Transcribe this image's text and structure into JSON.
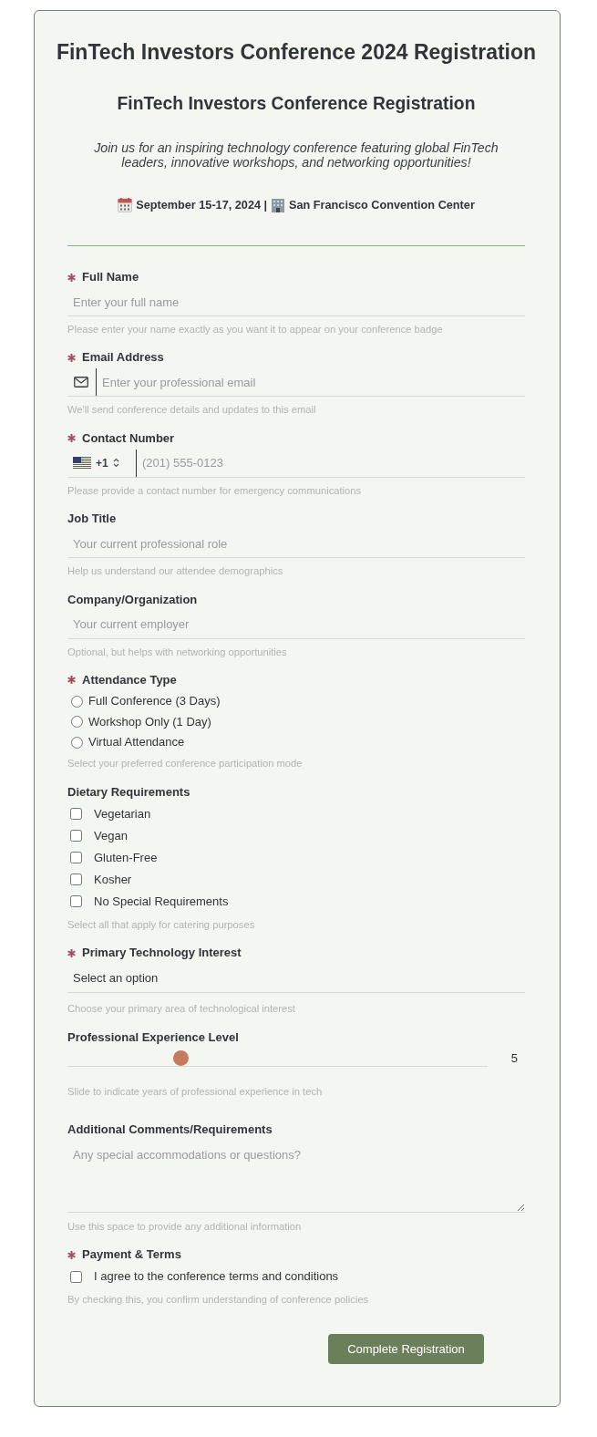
{
  "header": {
    "title": "FinTech Investors Conference 2024 Registration",
    "subtitle": "FinTech Investors Conference Registration",
    "description": "Join us for an inspiring technology conference featuring global FinTech leaders, innovative workshops, and networking opportunities!",
    "event_details": [
      {
        "kind": "date",
        "text": "September 15-17, 2024 |"
      },
      {
        "kind": "venue",
        "text": "San Francisco Convention Center"
      }
    ]
  },
  "fields": [
    {
      "kind": "text",
      "label": "Full Name",
      "required": true,
      "placeholder": "Enter your full name",
      "help": "Please enter your name exactly as you want it to appear on your conference badge"
    },
    {
      "kind": "email",
      "label": "Email Address",
      "required": true,
      "placeholder": "Enter your professional email",
      "help": "We'll send conference details and updates to this email"
    },
    {
      "kind": "phone",
      "label": "Contact Number",
      "required": true,
      "country_code": "+1",
      "placeholder": "(201) 555-0123",
      "help": "Please provide a contact number for emergency communications"
    },
    {
      "kind": "text",
      "label": "Job Title",
      "required": false,
      "placeholder": "Your current professional role",
      "help": "Help us understand our attendee demographics"
    },
    {
      "kind": "text",
      "label": "Company/Organization",
      "required": false,
      "placeholder": "Your current employer",
      "help": "Optional, but helps with networking opportunities"
    },
    {
      "kind": "radio",
      "label": "Attendance Type",
      "required": true,
      "options": [
        {
          "label": "Full Conference (3 Days)",
          "selected": false
        },
        {
          "label": "Workshop Only (1 Day)",
          "selected": false
        },
        {
          "label": "Virtual Attendance",
          "selected": false
        }
      ],
      "help": "Select your preferred conference participation mode"
    },
    {
      "kind": "checkbox",
      "label": "Dietary Requirements",
      "required": false,
      "options": [
        {
          "label": "Vegetarian",
          "checked": false
        },
        {
          "label": "Vegan",
          "checked": false
        },
        {
          "label": "Gluten-Free",
          "checked": false
        },
        {
          "label": "Kosher",
          "checked": false
        },
        {
          "label": "No Special Requirements",
          "checked": false
        }
      ],
      "help": "Select all that apply for catering purposes"
    },
    {
      "kind": "select",
      "label": "Primary Technology Interest",
      "required": true,
      "value": "Select an option",
      "help": "Choose your primary area of technological interest"
    },
    {
      "kind": "slider",
      "label": "Professional Experience Level",
      "required": false,
      "level": 0.27,
      "reading": "5",
      "help": "Slide to indicate years of professional experience in tech"
    },
    {
      "kind": "textarea",
      "label": "Additional Comments/Requirements",
      "required": false,
      "placeholder": "Any special accommodations or questions?",
      "help": "Use this space to provide any additional information"
    },
    {
      "kind": "checkbox",
      "label": "Payment & Terms",
      "required": true,
      "options": [
        {
          "label": "I agree to the conference terms and conditions",
          "checked": false
        }
      ],
      "help": "By checking this, you confirm understanding of conference policies"
    }
  ],
  "submit_button": "Complete Registration"
}
